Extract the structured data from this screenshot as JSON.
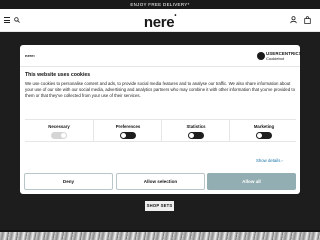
{
  "promo_bar": {
    "text": "ENJOY FREE DELIVERY*"
  },
  "header": {
    "logo_text": "nere",
    "logo_mark": "•",
    "icons": [
      "hamburger-menu-icon",
      "search-icon",
      "user-icon",
      "shopping-bag-icon"
    ]
  },
  "hero": {
    "button_label": "SHOP SETS"
  },
  "cookie_dialog": {
    "brand_mark": "nere•",
    "provider_name": "USERCENTRICS",
    "provider_sub": "Cookiebot",
    "title": "This website uses cookies",
    "body": "We use cookies to personalise content and ads, to provide social media features and to analyse our traffic. We also share information about your use of our site with our social media, advertising and analytics partners who may combine it with other information that you've provided to them or that they've collected from your use of their services.",
    "toggles": [
      {
        "label": "Necessary",
        "state": "on",
        "disabled": true
      },
      {
        "label": "Preferences",
        "state": "off",
        "disabled": false
      },
      {
        "label": "Statistics",
        "state": "off",
        "disabled": false
      },
      {
        "label": "Marketing",
        "state": "off",
        "disabled": false
      }
    ],
    "show_details": "Show details",
    "buttons": {
      "deny": "Deny",
      "allow_selection": "Allow selection",
      "allow_all": "Allow all"
    }
  }
}
